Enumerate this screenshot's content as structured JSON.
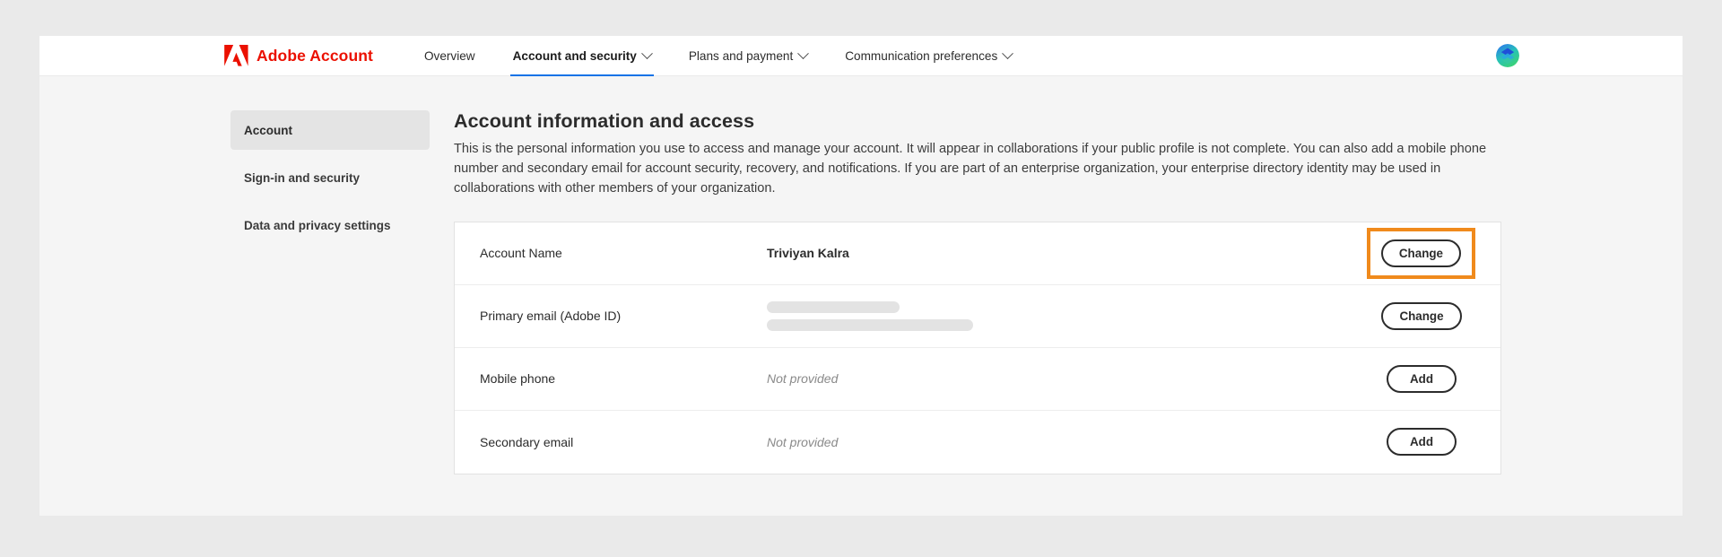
{
  "topbar": {
    "logo_icon": "adobe-logo-icon",
    "brand": "Adobe Account",
    "avatar_icon": "user-avatar-icon",
    "nav": [
      {
        "label": "Overview",
        "has_caret": false,
        "active": false
      },
      {
        "label": "Account and security",
        "has_caret": true,
        "active": true
      },
      {
        "label": "Plans and payment",
        "has_caret": true,
        "active": false
      },
      {
        "label": "Communication preferences",
        "has_caret": true,
        "active": false
      }
    ]
  },
  "sidebar": {
    "items": [
      {
        "label": "Account",
        "active": true
      },
      {
        "label": "Sign-in and security",
        "active": false
      },
      {
        "label": "Data and privacy settings",
        "active": false
      }
    ]
  },
  "main": {
    "title": "Account information and access",
    "description": "This is the personal information you use to access and manage your account. It will appear in collaborations if your public profile is not complete. You can also add a mobile phone number and secondary email for account security, recovery, and notifications. If you are part of an enterprise organization, your enterprise directory identity may be used in collaborations with other members of your organization.",
    "rows": [
      {
        "label": "Account Name",
        "value": "Triviyan Kalra",
        "value_type": "text",
        "action": "Change",
        "highlighted": true
      },
      {
        "label": "Primary email (Adobe ID)",
        "value": "",
        "value_type": "redacted",
        "action": "Change",
        "highlighted": false
      },
      {
        "label": "Mobile phone",
        "value": "Not provided",
        "value_type": "muted",
        "action": "Add",
        "highlighted": false
      },
      {
        "label": "Secondary email",
        "value": "Not provided",
        "value_type": "muted",
        "action": "Add",
        "highlighted": false
      }
    ]
  },
  "colors": {
    "adobe_red": "#eb1000",
    "active_tab_underline": "#1473e6",
    "highlight_box": "#f08a1c",
    "page_background": "#f5f5f5",
    "card_background": "#ffffff",
    "muted_text": "#8a8a8a"
  }
}
